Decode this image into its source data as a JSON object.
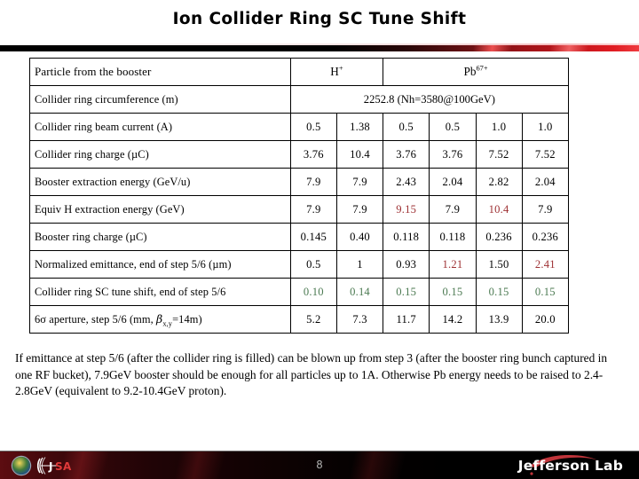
{
  "title": "Ion Collider Ring SC Tune Shift",
  "table": {
    "label_header": "Particle from the booster",
    "group_headers": [
      {
        "label": "H",
        "sup": "+",
        "span": 2
      },
      {
        "label": "Pb",
        "sup": "67+",
        "span": 4
      }
    ],
    "circumference_row": {
      "label": "Collider ring circumference (m)",
      "value": "2252.8 (Nh=3580@100GeV)"
    },
    "rows": [
      {
        "label": "Collider ring beam current (A)",
        "values": [
          "0.5",
          "1.38",
          "0.5",
          "0.5",
          "1.0",
          "1.0"
        ],
        "colors": [
          "black",
          "black",
          "black",
          "black",
          "black",
          "black"
        ]
      },
      {
        "label": "Collider ring charge (µC)",
        "values": [
          "3.76",
          "10.4",
          "3.76",
          "3.76",
          "7.52",
          "7.52"
        ],
        "colors": [
          "black",
          "black",
          "black",
          "black",
          "black",
          "black"
        ]
      },
      {
        "label": "Booster extraction energy (GeV/u)",
        "values": [
          "7.9",
          "7.9",
          "2.43",
          "2.04",
          "2.82",
          "2.04"
        ],
        "colors": [
          "black",
          "black",
          "black",
          "black",
          "black",
          "black"
        ]
      },
      {
        "label": "Equiv H extraction energy (GeV)",
        "values": [
          "7.9",
          "7.9",
          "9.15",
          "7.9",
          "10.4",
          "7.9"
        ],
        "colors": [
          "black",
          "black",
          "red",
          "black",
          "red",
          "black"
        ]
      },
      {
        "label": "Booster ring charge (µC)",
        "values": [
          "0.145",
          "0.40",
          "0.118",
          "0.118",
          "0.236",
          "0.236"
        ],
        "colors": [
          "black",
          "black",
          "black",
          "black",
          "black",
          "black"
        ]
      },
      {
        "label": "Normalized emittance, end of step 5/6 (µm)",
        "values": [
          "0.5",
          "1",
          "0.93",
          "1.21",
          "1.50",
          "2.41"
        ],
        "colors": [
          "black",
          "black",
          "black",
          "red",
          "black",
          "red"
        ]
      },
      {
        "label": "Collider ring SC tune shift, end of step 5/6",
        "values": [
          "0.10",
          "0.14",
          "0.15",
          "0.15",
          "0.15",
          "0.15"
        ],
        "colors": [
          "green",
          "green",
          "green",
          "green",
          "green",
          "green"
        ]
      },
      {
        "label": "6σ aperture, step 5/6 (mm, βx,y=14m)",
        "label_parts": {
          "pre": "6σ aperture, step 5/6 (mm, ",
          "beta": "β",
          "sub": "x,y",
          "post": "=14m)"
        },
        "values": [
          "5.2",
          "7.3",
          "11.7",
          "14.2",
          "13.9",
          "20.0"
        ],
        "colors": [
          "black",
          "black",
          "black",
          "black",
          "black",
          "black"
        ]
      }
    ]
  },
  "note": "If emittance at step 5/6 (after the collider ring is filled) can be blown up from step 3 (after the booster ring bunch captured in one RF bucket), 7.9GeV booster should be enough for all particles up to 1A. Otherwise Pb energy needs to be raised to 2.4-2.8GeV (equivalent to 9.2-10.4GeV proton).",
  "footer": {
    "page_number": "8",
    "lab_name": "Jefferson Lab",
    "jsa_name": "JSA",
    "doe_seal_name": "doe-seal"
  },
  "colors": {
    "red_text": "#9e3134",
    "green_text": "#4c7a52",
    "accent_red": "#c4161c"
  }
}
